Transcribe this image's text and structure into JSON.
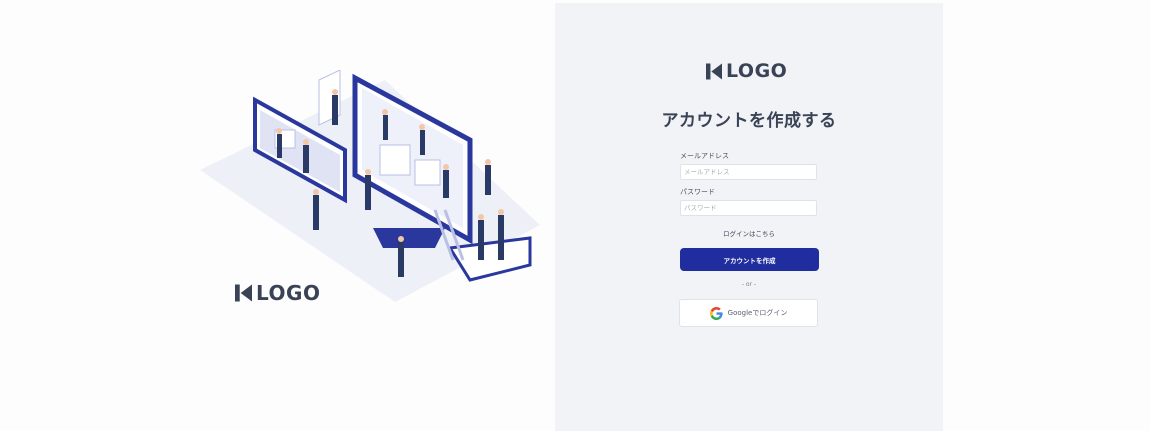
{
  "brand": {
    "logo_text": "LOGO"
  },
  "signup": {
    "title": "アカウントを作成する",
    "email_label": "メールアドレス",
    "email_placeholder": "メールアドレス",
    "password_label": "パスワード",
    "password_placeholder": "パスワード",
    "login_link": "ログインはこちら",
    "submit_label": "アカウントを作成",
    "or_text": "- or -",
    "google_label": "Googleでログイン"
  },
  "colors": {
    "primary": "#1f2d9e",
    "panel_bg": "#f1f3f6",
    "text": "#3a4256"
  },
  "icons": {
    "illustration": "isometric-team-building-website-illustration",
    "logo": "k-logo-mark",
    "google": "google-g-icon"
  }
}
